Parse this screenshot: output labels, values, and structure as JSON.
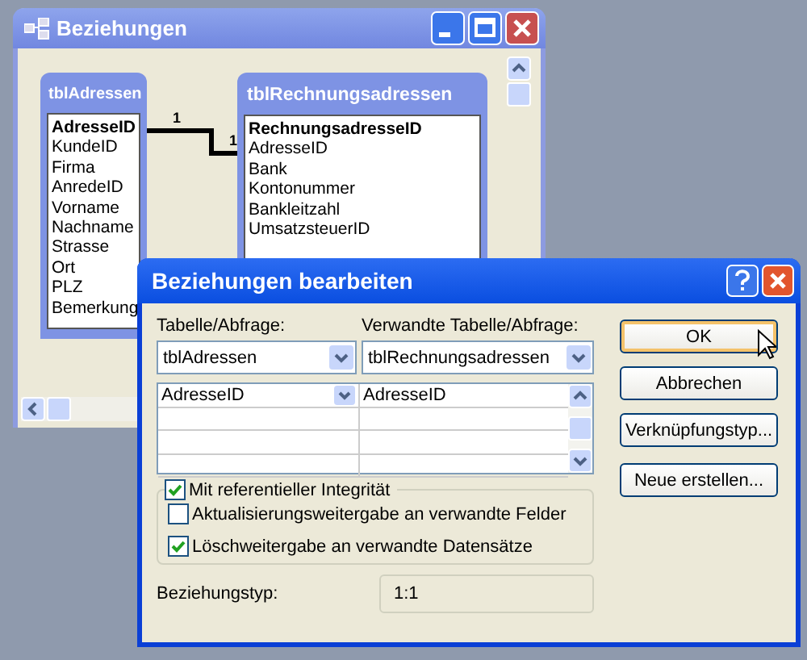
{
  "background_window": {
    "title": "Beziehungen",
    "tables": [
      {
        "title": "tblAdressen",
        "fields": [
          {
            "name": "AdresseID",
            "primary": true
          },
          {
            "name": "KundeID",
            "primary": false
          },
          {
            "name": "Firma",
            "primary": false
          },
          {
            "name": "AnredeID",
            "primary": false
          },
          {
            "name": "Vorname",
            "primary": false
          },
          {
            "name": "Nachname",
            "primary": false
          },
          {
            "name": "Strasse",
            "primary": false
          },
          {
            "name": "Ort",
            "primary": false
          },
          {
            "name": "PLZ",
            "primary": false
          },
          {
            "name": "Bemerkung",
            "primary": false
          }
        ]
      },
      {
        "title": "tblRechnungsadressen",
        "fields": [
          {
            "name": "RechnungsadresseID",
            "primary": true
          },
          {
            "name": "AdresseID",
            "primary": false
          },
          {
            "name": "Bank",
            "primary": false
          },
          {
            "name": "Kontonummer",
            "primary": false
          },
          {
            "name": "Bankleitzahl",
            "primary": false
          },
          {
            "name": "UmsatzsteuerID",
            "primary": false
          }
        ]
      }
    ],
    "relationship": {
      "from_label": "1",
      "to_label": "1"
    }
  },
  "dialog": {
    "title": "Beziehungen bearbeiten",
    "table_label": "Tabelle/Abfrage:",
    "table_value": "tblAdressen",
    "related_label": "Verwandte Tabelle/Abfrage:",
    "related_value": "tblRechnungsadressen",
    "field_rows": [
      {
        "field": "AdresseID",
        "related": "AdresseID"
      }
    ],
    "options": [
      {
        "label": "Mit referentieller Integrität",
        "checked": true
      },
      {
        "label": "Aktualisierungsweitergabe an verwandte Felder",
        "checked": false
      },
      {
        "label": "Löschweitergabe an verwandte Datensätze",
        "checked": true
      }
    ],
    "relation_type_label": "Beziehungstyp:",
    "relation_type_value": "1:1",
    "buttons": [
      {
        "label": "OK",
        "default": true
      },
      {
        "label": "Abbrechen",
        "default": false
      },
      {
        "label": "Verknüpfungstyp...",
        "default": false
      },
      {
        "label": "Neue erstellen...",
        "default": false
      }
    ]
  }
}
